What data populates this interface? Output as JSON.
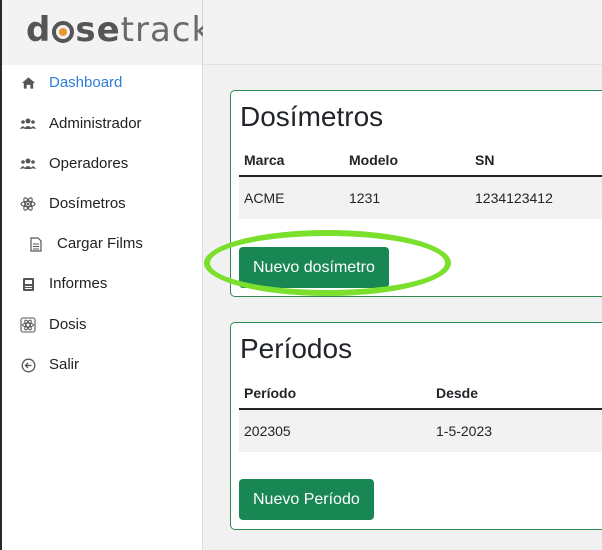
{
  "brand": {
    "logo_prefix": "d",
    "logo_bold": "se",
    "logo_light": "track"
  },
  "colors": {
    "accent": "#198754",
    "active_link": "#2f7ed8",
    "highlight": "#7be02c"
  },
  "sidebar": {
    "items": [
      {
        "label": "Dashboard",
        "icon": "home-icon",
        "active": true
      },
      {
        "label": "Administrador",
        "icon": "users-icon"
      },
      {
        "label": "Operadores",
        "icon": "users-icon"
      },
      {
        "label": "Dosímetros",
        "icon": "atom-icon"
      },
      {
        "label": "Cargar Films",
        "icon": "file-icon"
      },
      {
        "label": "Informes",
        "icon": "report-icon"
      },
      {
        "label": "Dosis",
        "icon": "atom-icon"
      },
      {
        "label": "Salir",
        "icon": "exit-icon"
      }
    ]
  },
  "dosimetros": {
    "title": "Dosímetros",
    "columns": [
      "Marca",
      "Modelo",
      "SN"
    ],
    "rows": [
      [
        "ACME",
        "1231",
        "1234123412"
      ]
    ],
    "button": "Nuevo dosímetro"
  },
  "periodos": {
    "title": "Períodos",
    "columns": [
      "Período",
      "Desde"
    ],
    "rows": [
      [
        "202305",
        "1-5-2023"
      ]
    ],
    "button": "Nuevo Período"
  }
}
